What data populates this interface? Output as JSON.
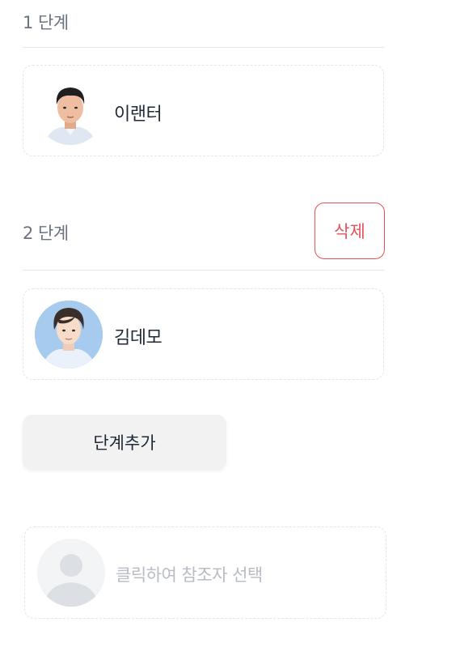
{
  "steps": [
    {
      "label": "1 단계",
      "approver": {
        "name": "이랜터",
        "avatar": "profile-photo-icon"
      }
    },
    {
      "label": "2 단계",
      "delete_label": "삭제",
      "approver": {
        "name": "김데모",
        "avatar": "profile-photo-icon"
      }
    }
  ],
  "add_step_label": "단계추가",
  "reference": {
    "placeholder": "클릭하여 참조자 선택",
    "avatar": "user-placeholder-icon"
  },
  "colors": {
    "accent_red": "#e8505b",
    "label_gray": "#6b7280",
    "placeholder_gray": "#b8bcc4",
    "button_bg": "#f2f2f3"
  }
}
